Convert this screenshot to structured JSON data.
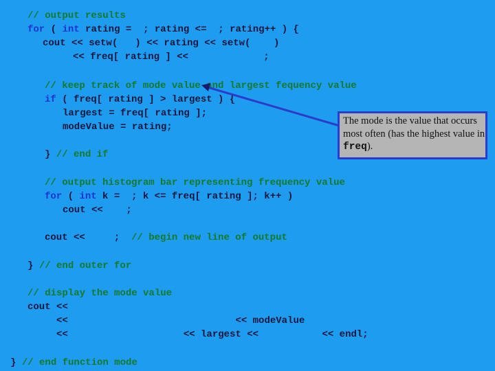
{
  "code_lines": [
    [
      {
        "t": "cm",
        "s": "// output results"
      }
    ],
    [
      {
        "t": "kw",
        "s": "for"
      },
      {
        "t": "c",
        "s": " ( "
      },
      {
        "t": "kw",
        "s": "int"
      },
      {
        "t": "c",
        "s": " rating =  ; rating <=  ; rating++ ) {"
      }
    ],
    [
      {
        "t": "c",
        "s": "cout << setw(   ) << rating << setw(    )"
      }
    ],
    [
      {
        "t": "c",
        "s": "<< freq[ rating ] <<             ;"
      }
    ],
    [
      {
        "t": "cm",
        "s": "// keep track of mode value and largest fequency value"
      }
    ],
    [
      {
        "t": "kw",
        "s": "if"
      },
      {
        "t": "c",
        "s": " ( freq[ rating ] > largest ) {"
      }
    ],
    [
      {
        "t": "c",
        "s": "largest = freq[ rating ];"
      }
    ],
    [
      {
        "t": "c",
        "s": "modeValue = rating;"
      }
    ],
    [
      {
        "t": "c",
        "s": "} "
      },
      {
        "t": "cm",
        "s": "// end if"
      }
    ],
    [
      {
        "t": "cm",
        "s": "// output histogram bar representing frequency value"
      }
    ],
    [
      {
        "t": "kw",
        "s": "for"
      },
      {
        "t": "c",
        "s": " ( "
      },
      {
        "t": "kw",
        "s": "int"
      },
      {
        "t": "c",
        "s": " k =  ; k <= freq[ rating ]; k++ )"
      }
    ],
    [
      {
        "t": "c",
        "s": "cout <<    ;"
      }
    ],
    [
      {
        "t": "c",
        "s": "cout <<     ;  "
      },
      {
        "t": "cm",
        "s": "// begin new line of output"
      }
    ],
    [
      {
        "t": "c",
        "s": "} "
      },
      {
        "t": "cm",
        "s": "// end outer for"
      }
    ],
    [
      {
        "t": "cm",
        "s": "// display the mode value"
      }
    ],
    [
      {
        "t": "c",
        "s": "cout <<"
      }
    ],
    [
      {
        "t": "c",
        "s": "<<                             << modeValue"
      }
    ],
    [
      {
        "t": "c",
        "s": "<<                    << largest <<           << endl;"
      }
    ],
    [
      {
        "t": "c",
        "s": "} "
      },
      {
        "t": "cm",
        "s": "// end function mode"
      }
    ]
  ],
  "callout": {
    "text_before": "The mode is the value that occurs most often (has the highest value in ",
    "code": "freq",
    "text_after": ")."
  },
  "colors": {
    "background": "#1e9cf0",
    "keyword": "#1a34d4",
    "comment": "#157a2a",
    "code": "#14163c",
    "callout_bg": "#b5b5b5",
    "callout_border": "#2a3ccc"
  }
}
